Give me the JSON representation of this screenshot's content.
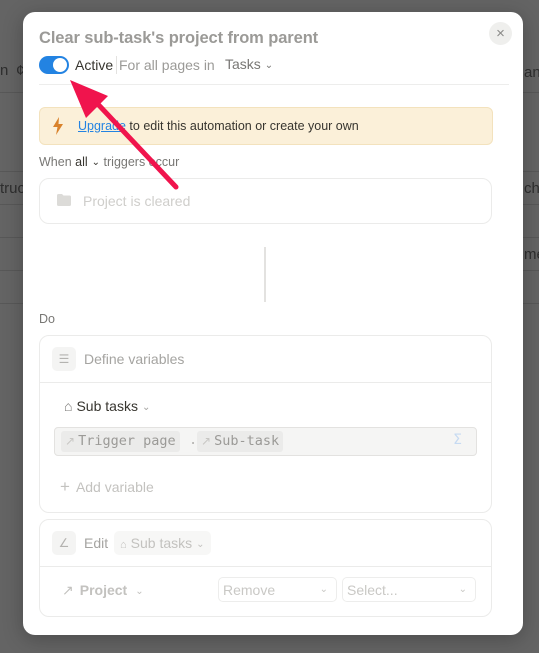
{
  "background": {
    "fragments_left": [
      "n",
      "¢",
      "truc"
    ],
    "fragments_right": [
      "ann",
      "che",
      "me"
    ]
  },
  "modal": {
    "title": "Clear sub-task's project from parent",
    "close_icon": "×",
    "toggle": {
      "state": "on",
      "label": "Active",
      "color": "#2383e2"
    },
    "scope_text": "For all pages in",
    "database": "Tasks",
    "banner": {
      "link": "Upgrade",
      "text": " to edit this automation or create your own",
      "color": "#fbf0d9"
    },
    "when": {
      "prefix": "When",
      "mode": "all",
      "suffix": "triggers occur"
    },
    "trigger": {
      "icon": "folder-icon",
      "label": "Project is cleared"
    },
    "do_label": "Do",
    "define_variables": {
      "label": "Define variables",
      "variable": {
        "name": "Sub tasks",
        "formula": [
          {
            "label": "Trigger page"
          },
          {
            "label": "Sub-task"
          }
        ],
        "separator": ".",
        "formula_icon": "Σ"
      },
      "add_label": "Add variable"
    },
    "edit": {
      "label": "Edit",
      "target": "Sub tasks",
      "property": "Project",
      "action": "Remove",
      "value_placeholder": "Select..."
    }
  },
  "annotation": {
    "type": "arrow",
    "color": "#f0144d"
  }
}
